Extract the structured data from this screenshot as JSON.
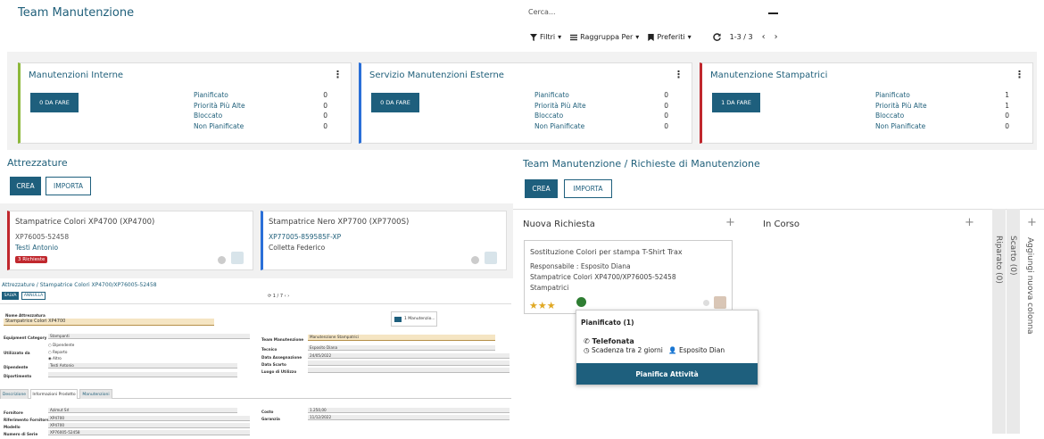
{
  "header": {
    "title": "Team Manutenzione",
    "search_placeholder": "Cerca...",
    "filters": "Filtri",
    "group_by": "Raggruppa Per",
    "favorites": "Preferiti",
    "pager": "1-3 / 3"
  },
  "teams": [
    {
      "name": "Manutenzioni Interne",
      "todo": "0 DA FARE",
      "color": "#8db83b",
      "stats": [
        {
          "label": "Pianificato",
          "value": "0"
        },
        {
          "label": "Priorità Più Alte",
          "value": "0"
        },
        {
          "label": "Bloccato",
          "value": "0"
        },
        {
          "label": "Non Pianificate",
          "value": "0"
        }
      ]
    },
    {
      "name": "Servizio Manutenzioni Esterne",
      "todo": "0 DA FARE",
      "color": "#2a6fd8",
      "stats": [
        {
          "label": "Pianificato",
          "value": "0"
        },
        {
          "label": "Priorità Più Alte",
          "value": "0"
        },
        {
          "label": "Bloccato",
          "value": "0"
        },
        {
          "label": "Non Pianificate",
          "value": "0"
        }
      ]
    },
    {
      "name": "Manutenzione Stampatrici",
      "todo": "1 DA FARE",
      "color": "#c0272d",
      "stats": [
        {
          "label": "Pianificato",
          "value": "1"
        },
        {
          "label": "Priorità Più Alte",
          "value": "1"
        },
        {
          "label": "Bloccato",
          "value": "0"
        },
        {
          "label": "Non Pianificate",
          "value": "0"
        }
      ]
    }
  ],
  "equipment": {
    "title": "Attrezzature",
    "create": "CREA",
    "import": "IMPORTA",
    "cards": [
      {
        "name": "Stampatrice Colori XP4700 (XP4700)",
        "serial": "XP76005-52458",
        "owner": "Testi Antonio",
        "badge": "3 Richieste",
        "color": "#c0272d"
      },
      {
        "name": "Stampatrice Nero XP7700 (XP7700S)",
        "serial": "XP77005-859585F-XP",
        "owner": "Colletta Federico",
        "badge": "",
        "color": "#2a6fd8"
      }
    ]
  },
  "form": {
    "breadcrumb": "Attrezzature / Stampatrice Colori XP4700/XP76005-52458",
    "save": "SALVA",
    "discard": "ANNULLA",
    "pager": "1 / 7",
    "smart_button": "1 Manutenzio...",
    "name_label": "Nome Attrezzatura",
    "name_value": "Stampatrice Colori XP4700",
    "category_label": "Equipment Category",
    "category_value": "Stampanti",
    "used_by_label": "Utilizzato da",
    "used_by_options": [
      "Dipendente",
      "Reparto",
      "Altro"
    ],
    "employee_label": "Dipendente",
    "employee_value": "Testi Antonio",
    "department_label": "Dipartimento",
    "team_label": "Team Manutenzione",
    "team_value": "Manutenzione Stampatrici",
    "tech_label": "Tecnico",
    "tech_value": "Esposito Diana",
    "assign_date_label": "Data Assegnazione",
    "assign_date_value": "24/05/2022",
    "scrap_date_label": "Data Scarto",
    "location_label": "Luogo di Utilizzo",
    "tabs": [
      "Descrizione",
      "Informazioni Prodotto",
      "Manutenzioni"
    ],
    "vendor_label": "Fornitore",
    "vendor_value": "Azimut Srl",
    "vendor_ref_label": "Riferimento Fornitore",
    "vendor_ref_value": "XP4700",
    "model_label": "Modello",
    "model_value": "XP4700",
    "serial_label": "Numero di Serie",
    "serial_value": "XP76005-52458",
    "cost_label": "Costo",
    "cost_value": "1.250,00",
    "warranty_label": "Garanzia",
    "warranty_value": "11/12/2022"
  },
  "requests": {
    "breadcrumb_parent": "Team Manutenzione /",
    "breadcrumb_current": "Richieste di Manutenzione",
    "create": "CREA",
    "import": "IMPORTA",
    "columns": [
      "Nuova Richiesta",
      "In Corso"
    ],
    "folded_columns": [
      "Riparato (0)",
      "Scarto (0)"
    ],
    "add_column": "Aggiungi nuova colonna",
    "card": {
      "title": "Sostituzione Colori per stampa T-Shirt Trax",
      "responsible": "Responsabile : Esposito Diana",
      "equipment": "Stampatrice Colori XP4700/XP76005-52458",
      "category": "Stampatrici"
    },
    "popover": {
      "header": "Pianificato (1)",
      "activity": "Telefonata",
      "due": "Scadenza tra 2 giorni",
      "user": "Esposito Dian",
      "button": "Pianifica Attività"
    }
  }
}
